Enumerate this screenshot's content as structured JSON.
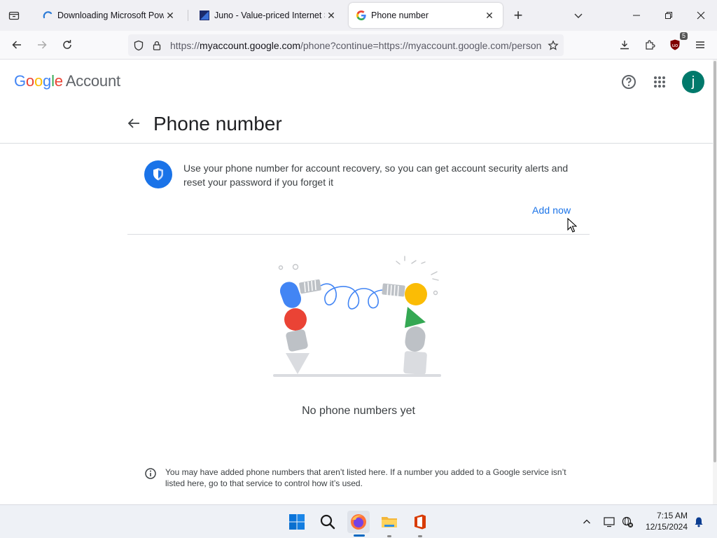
{
  "browser": {
    "tabs": [
      {
        "title": "Downloading Microsoft PowerPoint",
        "favicon": "microsoft-loading-icon",
        "active": false
      },
      {
        "title": "Juno - Value-priced Internet Service",
        "favicon": "juno-icon",
        "active": false
      },
      {
        "title": "Phone number",
        "favicon": "google-g-icon",
        "active": true
      }
    ],
    "url_prefix": "https://",
    "url_host": "myaccount.google.com",
    "url_rest": "/phone?continue=https://myaccount.google.com/personal-info",
    "extension_badge": "5"
  },
  "header": {
    "logo_word": "Google",
    "logo_product": "Account",
    "avatar_initial": "j"
  },
  "page": {
    "title": "Phone number",
    "info_text": "Use your phone number for account recovery, so you can get account security alerts and reset your password if you forget it",
    "add_now_label": "Add now",
    "empty_state": "No phone numbers yet",
    "footnote": "You may have added phone numbers that aren’t listed here. If a number you added to a Google service isn’t listed here, go to that service to control how it’s used."
  },
  "colors": {
    "accent": "#1a73e8",
    "avatar": "#00796b",
    "google_blue": "#4285f4",
    "google_red": "#ea4335",
    "google_yellow": "#fbbc05",
    "google_green": "#34a853"
  },
  "taskbar": {
    "time": "7:15 AM",
    "date": "12/15/2024",
    "pinned": [
      "windows-start-icon",
      "search-icon",
      "firefox-icon",
      "file-explorer-icon",
      "office-icon"
    ]
  }
}
